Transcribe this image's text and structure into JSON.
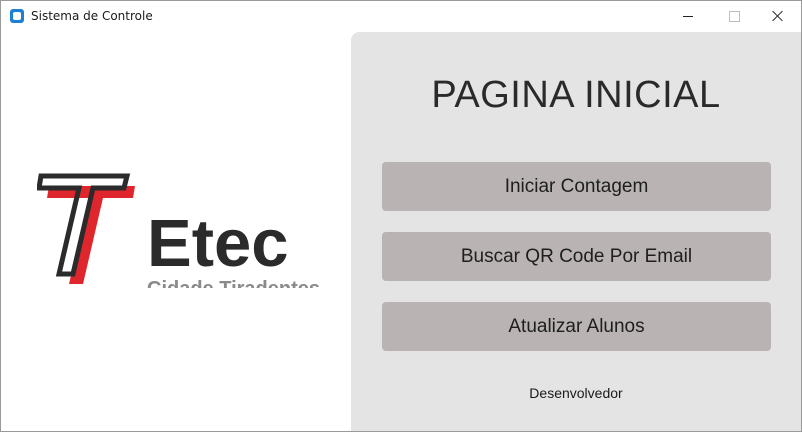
{
  "window": {
    "title": "Sistema de Controle",
    "icons": {
      "app": "app-icon",
      "minimize": "minimize-icon",
      "maximize": "maximize-icon",
      "close": "close-icon"
    }
  },
  "logo": {
    "brand": "Etec",
    "subtitle": "Cidade Tiradentes",
    "colors": {
      "red": "#e0262d",
      "dark": "#2b2b2b",
      "subtitle_gray": "#8a8a8a"
    }
  },
  "main": {
    "title": "PAGINA INICIAL",
    "buttons": [
      {
        "label": "Iniciar Contagem"
      },
      {
        "label": "Buscar QR Code Por Email"
      },
      {
        "label": "Atualizar Alunos"
      }
    ],
    "developer_label": "Desenvolvedor",
    "colors": {
      "panel_bg": "#e4e4e4",
      "button_bg": "#b9b3b3"
    }
  }
}
